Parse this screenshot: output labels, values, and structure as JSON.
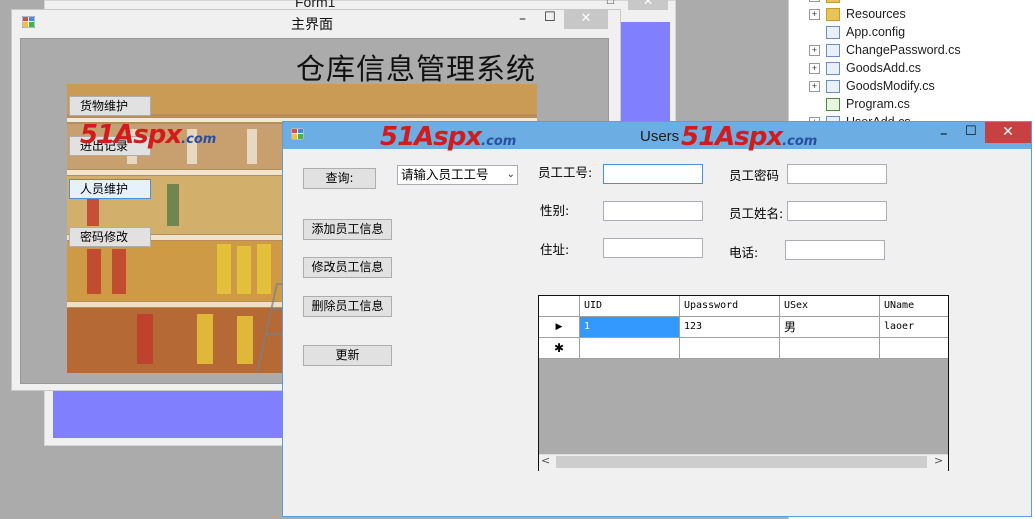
{
  "solution_explorer": {
    "items": [
      {
        "label": "Resources",
        "icon": "folder-icon",
        "expand": "+"
      },
      {
        "label": "App.config",
        "icon": "config-file-icon",
        "expand": ""
      },
      {
        "label": "ChangePassword.cs",
        "icon": "form-file-icon",
        "expand": "+"
      },
      {
        "label": "GoodsAdd.cs",
        "icon": "form-file-icon",
        "expand": "+"
      },
      {
        "label": "GoodsModify.cs",
        "icon": "form-file-icon",
        "expand": "+"
      },
      {
        "label": "Program.cs",
        "icon": "csharp-file-icon",
        "expand": ""
      },
      {
        "label": "UserAdd.cs",
        "icon": "form-file-icon",
        "expand": "+"
      }
    ]
  },
  "form1": {
    "title": "Form1",
    "close": "✕",
    "accent": "#8080ff"
  },
  "main_window": {
    "title": "主界面",
    "min": "–",
    "max": "☐",
    "close": "✕",
    "heading": "仓库信息管理系统",
    "buttons": [
      "货物维护",
      "进出记录",
      "人员维护",
      "密码修改"
    ]
  },
  "users_window": {
    "title": "Users",
    "min": "–",
    "max": "☐",
    "close": "✕",
    "titlebar_color": "#6caee4",
    "close_color": "#c74141",
    "watermark": {
      "brand": "51Aspx",
      "suffix": ".com"
    },
    "buttons": {
      "query": "查询:",
      "add": "添加员工信息",
      "modify": "修改员工信息",
      "delete": "删除员工信息",
      "refresh": "更新"
    },
    "combo": {
      "value": "请输入员工工号"
    },
    "labels": {
      "uid": "员工工号:",
      "password": "员工密码",
      "sex": "性别:",
      "name": "员工姓名:",
      "address": "住址:",
      "phone": "电话:"
    },
    "grid": {
      "columns": [
        "UID",
        "Upassword",
        "USex",
        "UName"
      ],
      "rows": [
        {
          "indicator": "▶",
          "cells": [
            "1",
            "123",
            "男",
            "laoer"
          ]
        },
        {
          "indicator": "✱",
          "cells": [
            "",
            "",
            "",
            ""
          ]
        }
      ]
    },
    "scroll": {
      "left": "<",
      "right": ">"
    }
  }
}
